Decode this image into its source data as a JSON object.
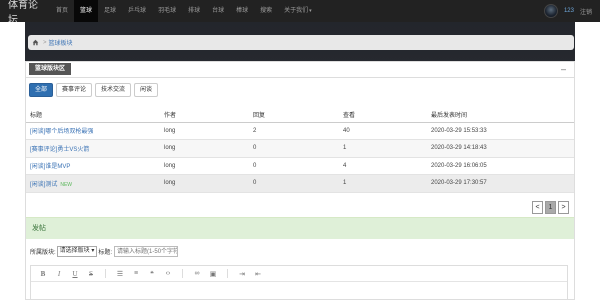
{
  "nav": {
    "brand": "体育论坛",
    "items": [
      {
        "label": "首页",
        "active": false
      },
      {
        "label": "篮球",
        "active": true
      },
      {
        "label": "足球",
        "active": false
      },
      {
        "label": "乒乓球",
        "active": false
      },
      {
        "label": "羽毛球",
        "active": false
      },
      {
        "label": "排球",
        "active": false
      },
      {
        "label": "台球",
        "active": false
      },
      {
        "label": "棒球",
        "active": false
      },
      {
        "label": "搜索",
        "active": false
      },
      {
        "label": "关于我们",
        "active": false,
        "dropdown": true
      }
    ],
    "user": "123",
    "logout": "注销"
  },
  "breadcrumb": {
    "separator": ">",
    "current": "篮球板块"
  },
  "panel": {
    "section_title": "篮球版块区",
    "collapse_symbol": "–",
    "tabs": [
      {
        "label": "全部",
        "active": true
      },
      {
        "label": "赛事评论",
        "active": false
      },
      {
        "label": "技术交流",
        "active": false
      },
      {
        "label": "闲谈",
        "active": false
      }
    ],
    "table": {
      "headers": [
        "标题",
        "作者",
        "回复",
        "查看",
        "最后发表时间"
      ],
      "rows": [
        {
          "title": "[闲谈]哪个后场双枪最强",
          "author": "long",
          "replies": "2",
          "views": "40",
          "last": "2020-03-29 15:53:33",
          "new": ""
        },
        {
          "title": "[赛事评论]勇士VS火箭",
          "author": "long",
          "replies": "0",
          "views": "1",
          "last": "2020-03-29 14:18:43",
          "new": ""
        },
        {
          "title": "[闲谈]谁是MVP",
          "author": "long",
          "replies": "0",
          "views": "4",
          "last": "2020-03-29 16:06:05",
          "new": ""
        },
        {
          "title": "[闲谈]测试",
          "author": "long",
          "replies": "0",
          "views": "1",
          "last": "2020-03-29 17:30:57",
          "new": "NEW"
        }
      ]
    },
    "pager": {
      "prev": "<",
      "current": "1",
      "next": ">"
    }
  },
  "compose": {
    "title": "发帖",
    "section_label": "所属版块:",
    "section_select": "请选择版块",
    "title_label": "标题:",
    "title_placeholder": "请输入标题(1-50个字符)"
  },
  "editor": {
    "tools": [
      "bold-icon",
      "italic-icon",
      "underline-icon",
      "strikethrough-icon",
      "ordered-list-icon",
      "unordered-list-icon",
      "quote-icon",
      "code-icon",
      "link-icon",
      "image-icon",
      "indent-icon",
      "outdent-icon"
    ]
  },
  "colors": {
    "nav_bg": "#222222",
    "accent": "#2f6fb0",
    "link": "#3b73b5",
    "compose_bg": "#dff0d8",
    "new_badge": "#5cb85c"
  }
}
